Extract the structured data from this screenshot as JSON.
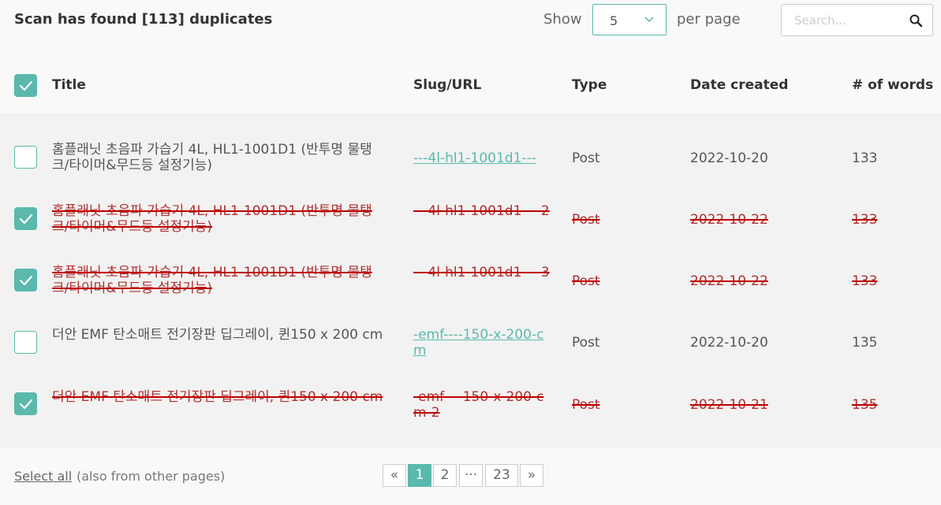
{
  "header": {
    "title": "Scan has found [113] duplicates",
    "show_label": "Show",
    "per_page_value": "5",
    "per_page_label": "per page",
    "search_placeholder": "Search..."
  },
  "table": {
    "columns": [
      "Title",
      "Slug/URL",
      "Type",
      "Date created",
      "# of words"
    ],
    "header_checked": true,
    "rows": [
      {
        "checked": false,
        "duplicate": false,
        "title": "홈플래닛 초음파 가습기 4L, HL1-1001D1 (반투명 물탱크/타이머&무드등 설정기능)",
        "slug": "---4l-hl1-1001d1---",
        "type": "Post",
        "date": "2022-10-20",
        "words": "133"
      },
      {
        "checked": true,
        "duplicate": true,
        "title": "홈플래닛 초음파 가습기 4L, HL1-1001D1 (반투명 물탱크/타이머&무드등 설정기능)",
        "slug": "---4l-hl1-1001d1----2",
        "type": "Post",
        "date": "2022-10-22",
        "words": "133"
      },
      {
        "checked": true,
        "duplicate": true,
        "title": "홈플래닛 초음파 가습기 4L, HL1-1001D1 (반투명 물탱크/타이머&무드등 설정기능)",
        "slug": "---4l-hl1-1001d1----3",
        "type": "Post",
        "date": "2022-10-22",
        "words": "133"
      },
      {
        "checked": false,
        "duplicate": false,
        "title": "더안 EMF 탄소매트 전기장판 딥그레이, 퀸150 x 200 cm",
        "slug": "-emf----150-x-200-cm",
        "type": "Post",
        "date": "2022-10-20",
        "words": "135"
      },
      {
        "checked": true,
        "duplicate": true,
        "title": "더안 EMF 탄소매트 전기장판 딥그레이, 퀸150 x 200 cm",
        "slug": "-emf----150-x-200-cm-2",
        "type": "Post",
        "date": "2022-10-21",
        "words": "135"
      }
    ]
  },
  "footer": {
    "select_all": "Select all",
    "select_all_note": "(also from other pages)"
  },
  "pagination": {
    "prev": "«",
    "pages": [
      "1",
      "2",
      "···",
      "23"
    ],
    "next": "»",
    "active": "1"
  },
  "colors": {
    "accent": "#5ab9ac",
    "duplicate_text": "#b03030"
  },
  "icons": {
    "search": "search-icon",
    "chevron": "chevron-down-icon",
    "check": "check-icon"
  }
}
